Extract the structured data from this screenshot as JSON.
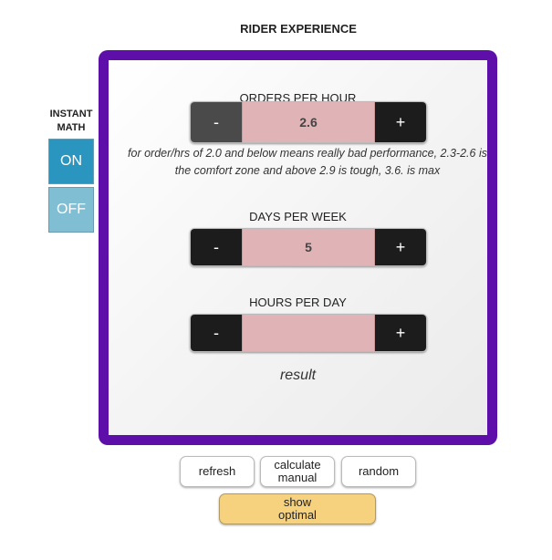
{
  "title": "RIDER EXPERIENCE",
  "instant_math": {
    "label": "INSTANT\nMATH",
    "on_label": "ON",
    "off_label": "OFF"
  },
  "fields": {
    "orders": {
      "label": "ORDERS PER HOUR",
      "value": "2.6",
      "minus": "-",
      "plus": "+",
      "note": "for order/hrs of 2.0 and below means really bad performance, 2.3-2.6 is the comfort zone and above 2.9 is tough, 3.6. is max"
    },
    "days": {
      "label": "DAYS PER WEEK",
      "value": "5",
      "minus": "-",
      "plus": "+"
    },
    "hours": {
      "label": "HOURS PER DAY",
      "value": "",
      "minus": "-",
      "plus": "+"
    }
  },
  "result": "result",
  "actions": {
    "refresh": "refresh",
    "calculate": "calculate\nmanual",
    "random": "random",
    "optimal": "show\noptimal"
  },
  "colors": {
    "frame": "#5f0fa9",
    "on": "#2a95be",
    "off": "#7fbed3",
    "value_bg": "#e0b3b6",
    "optimal": "#f6d27e"
  }
}
